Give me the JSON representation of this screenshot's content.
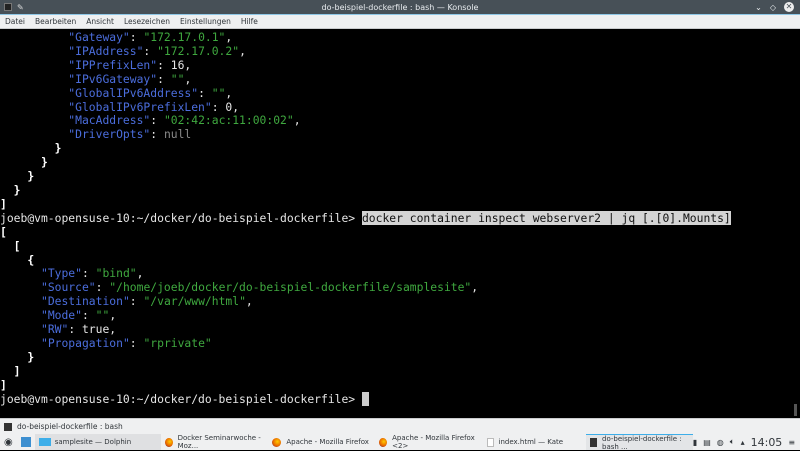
{
  "window": {
    "title": "do-beispiel-dockerfile : bash — Konsole"
  },
  "menu": [
    "Datei",
    "Bearbeiten",
    "Ansicht",
    "Lesezeichen",
    "Einstellungen",
    "Hilfe"
  ],
  "terminal": {
    "lines": [
      [
        [
          "p",
          "          "
        ],
        [
          "k",
          "\"Gateway\""
        ],
        [
          "p",
          ": "
        ],
        [
          "s",
          "\"172.17.0.1\""
        ],
        [
          "p",
          ","
        ]
      ],
      [
        [
          "p",
          "          "
        ],
        [
          "k",
          "\"IPAddress\""
        ],
        [
          "p",
          ": "
        ],
        [
          "s",
          "\"172.17.0.2\""
        ],
        [
          "p",
          ","
        ]
      ],
      [
        [
          "p",
          "          "
        ],
        [
          "k",
          "\"IPPrefixLen\""
        ],
        [
          "p",
          ": 16,"
        ]
      ],
      [
        [
          "p",
          "          "
        ],
        [
          "k",
          "\"IPv6Gateway\""
        ],
        [
          "p",
          ": "
        ],
        [
          "s",
          "\"\""
        ],
        [
          "p",
          ","
        ]
      ],
      [
        [
          "p",
          "          "
        ],
        [
          "k",
          "\"GlobalIPv6Address\""
        ],
        [
          "p",
          ": "
        ],
        [
          "s",
          "\"\""
        ],
        [
          "p",
          ","
        ]
      ],
      [
        [
          "p",
          "          "
        ],
        [
          "k",
          "\"GlobalIPv6PrefixLen\""
        ],
        [
          "p",
          ": 0,"
        ]
      ],
      [
        [
          "p",
          "          "
        ],
        [
          "k",
          "\"MacAddress\""
        ],
        [
          "p",
          ": "
        ],
        [
          "s",
          "\"02:42:ac:11:00:02\""
        ],
        [
          "p",
          ","
        ]
      ],
      [
        [
          "p",
          "          "
        ],
        [
          "k",
          "\"DriverOpts\""
        ],
        [
          "p",
          ": "
        ],
        [
          "n",
          "null"
        ]
      ],
      [
        [
          "p",
          "        "
        ],
        [
          "b",
          "}"
        ]
      ],
      [
        [
          "p",
          "      "
        ],
        [
          "b",
          "}"
        ]
      ],
      [
        [
          "p",
          "    "
        ],
        [
          "b",
          "}"
        ]
      ],
      [
        [
          "p",
          "  "
        ],
        [
          "b",
          "}"
        ]
      ],
      [
        [
          "b",
          "]"
        ]
      ],
      [
        [
          "p",
          "joeb@vm-opensuse-10:~/docker/do-beispiel-dockerfile> "
        ],
        [
          "sel",
          "docker container inspect webserver2 | jq [.[0].Mounts]"
        ]
      ],
      [
        [
          "b",
          "["
        ]
      ],
      [
        [
          "p",
          "  "
        ],
        [
          "b",
          "["
        ]
      ],
      [
        [
          "p",
          "    "
        ],
        [
          "b",
          "{"
        ]
      ],
      [
        [
          "p",
          "      "
        ],
        [
          "k",
          "\"Type\""
        ],
        [
          "p",
          ": "
        ],
        [
          "s",
          "\"bind\""
        ],
        [
          "p",
          ","
        ]
      ],
      [
        [
          "p",
          "      "
        ],
        [
          "k",
          "\"Source\""
        ],
        [
          "p",
          ": "
        ],
        [
          "s",
          "\"/home/joeb/docker/do-beispiel-dockerfile/samplesite\""
        ],
        [
          "p",
          ","
        ]
      ],
      [
        [
          "p",
          "      "
        ],
        [
          "k",
          "\"Destination\""
        ],
        [
          "p",
          ": "
        ],
        [
          "s",
          "\"/var/www/html\""
        ],
        [
          "p",
          ","
        ]
      ],
      [
        [
          "p",
          "      "
        ],
        [
          "k",
          "\"Mode\""
        ],
        [
          "p",
          ": "
        ],
        [
          "s",
          "\"\""
        ],
        [
          "p",
          ","
        ]
      ],
      [
        [
          "p",
          "      "
        ],
        [
          "k",
          "\"RW\""
        ],
        [
          "p",
          ": true,"
        ]
      ],
      [
        [
          "p",
          "      "
        ],
        [
          "k",
          "\"Propagation\""
        ],
        [
          "p",
          ": "
        ],
        [
          "s",
          "\"rprivate\""
        ]
      ],
      [
        [
          "p",
          "    "
        ],
        [
          "b",
          "}"
        ]
      ],
      [
        [
          "p",
          "  "
        ],
        [
          "b",
          "]"
        ]
      ],
      [
        [
          "b",
          "]"
        ]
      ],
      [
        [
          "p",
          "joeb@vm-opensuse-10:~/docker/do-beispiel-dockerfile> "
        ],
        [
          "cursor",
          " "
        ]
      ]
    ]
  },
  "tab": {
    "label": "do-beispiel-dockerfile : bash"
  },
  "taskbar": {
    "tasks": [
      {
        "label": "samplesite — Dolphin",
        "icon": "folder-icon"
      },
      {
        "label": "Docker Seminarwoche - Moz...",
        "icon": "firefox-icon"
      },
      {
        "label": "Apache - Mozilla Firefox",
        "icon": "firefox-icon"
      },
      {
        "label": "Apache - Mozilla Firefox <2>",
        "icon": "firefox-icon"
      },
      {
        "label": "index.html — Kate",
        "icon": "document-icon"
      },
      {
        "label": "do-beispiel-dockerfile : bash ...",
        "icon": "konsole-icon"
      }
    ],
    "clock": "14:05"
  },
  "colors": {
    "key": "#4b6ddc",
    "string": "#3fa83f",
    "null": "#8a8a8a",
    "accent": "#3daee9"
  }
}
